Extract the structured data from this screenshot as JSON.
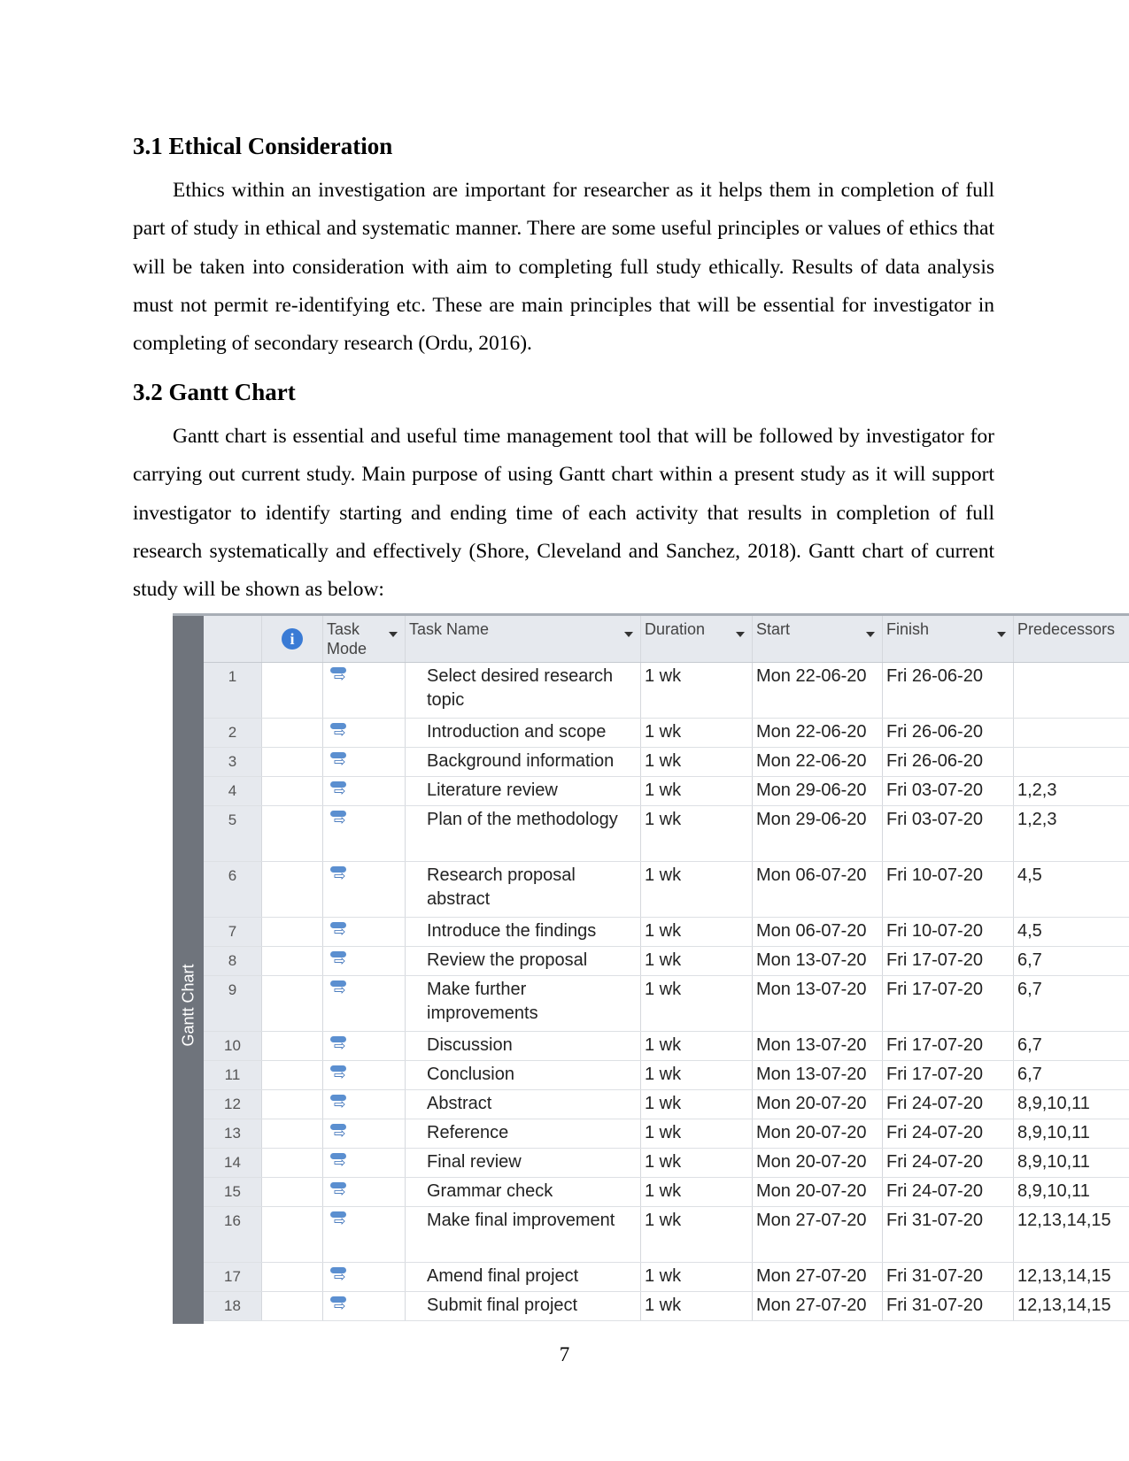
{
  "section1": {
    "heading": "3.1 Ethical Consideration",
    "body": "Ethics within an investigation are important for researcher as it helps them in completion of full part of study in ethical and systematic manner. There are some useful principles or values of ethics that will be taken into consideration with aim to completing full study ethically. Results of data analysis must not permit re-identifying etc. These are main principles that will be essential for investigator in completing of secondary research (Ordu, 2016)."
  },
  "section2": {
    "heading": "3.2 Gantt Chart",
    "body": "Gantt chart is essential and useful time management tool that will be followed by investigator for carrying out current study. Main purpose of using Gantt chart within a present study as it will support investigator to identify starting and ending time of each activity that results in completion of full research systematically and effectively (Shore, Cleveland and Sanchez, 2018). Gantt chart of current study will be shown as below:"
  },
  "gantt": {
    "side_label": "Gantt Chart",
    "info_icon": "i",
    "headers": {
      "task_mode": "Task Mode",
      "task_name": "Task Name",
      "duration": "Duration",
      "start": "Start",
      "finish": "Finish",
      "predecessors": "Predecessors"
    },
    "rows": [
      {
        "id": "1",
        "name": "Select desired research topic",
        "duration": "1 wk",
        "start": "Mon 22-06-20",
        "finish": "Fri 26-06-20",
        "pred": ""
      },
      {
        "id": "2",
        "name": "Introduction and scope",
        "duration": "1 wk",
        "start": "Mon 22-06-20",
        "finish": "Fri 26-06-20",
        "pred": ""
      },
      {
        "id": "3",
        "name": "Background information",
        "duration": "1 wk",
        "start": "Mon 22-06-20",
        "finish": "Fri 26-06-20",
        "pred": ""
      },
      {
        "id": "4",
        "name": "Literature review",
        "duration": "1 wk",
        "start": "Mon 29-06-20",
        "finish": "Fri 03-07-20",
        "pred": "1,2,3"
      },
      {
        "id": "5",
        "name": "Plan of the methodology",
        "duration": "1 wk",
        "start": "Mon 29-06-20",
        "finish": "Fri 03-07-20",
        "pred": "1,2,3"
      },
      {
        "id": "6",
        "name": "Research proposal abstract",
        "duration": "1 wk",
        "start": "Mon 06-07-20",
        "finish": "Fri 10-07-20",
        "pred": "4,5"
      },
      {
        "id": "7",
        "name": "Introduce the findings",
        "duration": "1 wk",
        "start": "Mon 06-07-20",
        "finish": "Fri 10-07-20",
        "pred": "4,5"
      },
      {
        "id": "8",
        "name": "Review the proposal",
        "duration": "1 wk",
        "start": "Mon 13-07-20",
        "finish": "Fri 17-07-20",
        "pred": "6,7"
      },
      {
        "id": "9",
        "name": "Make further improvements",
        "duration": "1 wk",
        "start": "Mon 13-07-20",
        "finish": "Fri 17-07-20",
        "pred": "6,7"
      },
      {
        "id": "10",
        "name": "Discussion",
        "duration": "1 wk",
        "start": "Mon 13-07-20",
        "finish": "Fri 17-07-20",
        "pred": "6,7"
      },
      {
        "id": "11",
        "name": "Conclusion",
        "duration": "1 wk",
        "start": "Mon 13-07-20",
        "finish": "Fri 17-07-20",
        "pred": "6,7"
      },
      {
        "id": "12",
        "name": "Abstract",
        "duration": "1 wk",
        "start": "Mon 20-07-20",
        "finish": "Fri 24-07-20",
        "pred": "8,9,10,11"
      },
      {
        "id": "13",
        "name": "Reference",
        "duration": "1 wk",
        "start": "Mon 20-07-20",
        "finish": "Fri 24-07-20",
        "pred": "8,9,10,11"
      },
      {
        "id": "14",
        "name": "Final review",
        "duration": "1 wk",
        "start": "Mon 20-07-20",
        "finish": "Fri 24-07-20",
        "pred": "8,9,10,11"
      },
      {
        "id": "15",
        "name": "Grammar check",
        "duration": "1 wk",
        "start": "Mon 20-07-20",
        "finish": "Fri 24-07-20",
        "pred": "8,9,10,11"
      },
      {
        "id": "16",
        "name": "Make final improvement",
        "duration": "1 wk",
        "start": "Mon 27-07-20",
        "finish": "Fri 31-07-20",
        "pred": "12,13,14,15"
      },
      {
        "id": "17",
        "name": "Amend final project",
        "duration": "1 wk",
        "start": "Mon 27-07-20",
        "finish": "Fri 31-07-20",
        "pred": "12,13,14,15"
      },
      {
        "id": "18",
        "name": "Submit final project",
        "duration": "1 wk",
        "start": "Mon 27-07-20",
        "finish": "Fri 31-07-20",
        "pred": "12,13,14,15"
      }
    ]
  },
  "page_number": "7"
}
